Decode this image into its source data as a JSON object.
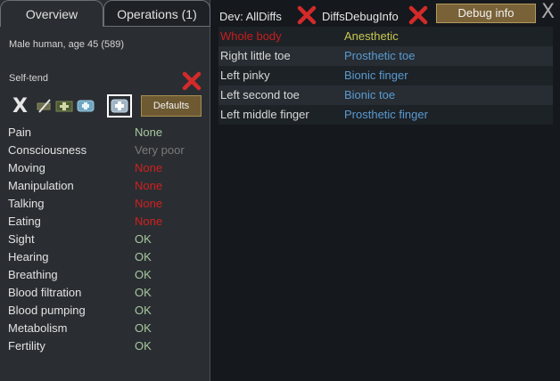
{
  "tabs": {
    "overview": "Overview",
    "operations": "Operations (1)"
  },
  "pawn": {
    "summary": "Male human, age 45 (589)"
  },
  "self_tend": {
    "label": "Self-tend"
  },
  "care": {
    "x_glyph": "X",
    "defaults_label": "Defaults"
  },
  "capacities": [
    {
      "name": "Pain",
      "value": "None",
      "color": "#a8c8a0"
    },
    {
      "name": "Consciousness",
      "value": "Very poor",
      "color": "#7a7a7a"
    },
    {
      "name": "Moving",
      "value": "None",
      "color": "#d02020"
    },
    {
      "name": "Manipulation",
      "value": "None",
      "color": "#d02020"
    },
    {
      "name": "Talking",
      "value": "None",
      "color": "#d02020"
    },
    {
      "name": "Eating",
      "value": "None",
      "color": "#d02020"
    },
    {
      "name": "Sight",
      "value": "OK",
      "color": "#a8c8a0"
    },
    {
      "name": "Hearing",
      "value": "OK",
      "color": "#a8c8a0"
    },
    {
      "name": "Breathing",
      "value": "OK",
      "color": "#a8c8a0"
    },
    {
      "name": "Blood filtration",
      "value": "OK",
      "color": "#a8c8a0"
    },
    {
      "name": "Blood pumping",
      "value": "OK",
      "color": "#a8c8a0"
    },
    {
      "name": "Metabolism",
      "value": "OK",
      "color": "#a8c8a0"
    },
    {
      "name": "Fertility",
      "value": "OK",
      "color": "#a8c8a0"
    }
  ],
  "debug_bar": {
    "all_diffs_label": "Dev: AllDiffs",
    "diffs_debug_label": "DiffsDebugInfo",
    "debug_info_label": "Debug info",
    "close_glyph": "X"
  },
  "diffs": [
    {
      "part": "Whole body",
      "state": "Anesthetic",
      "part_color": "#c81e1e",
      "state_color": "#c8c850"
    },
    {
      "part": "Right little toe",
      "state": "Prosthetic toe",
      "part_color": "#d8d8d8",
      "state_color": "#5a9ad0"
    },
    {
      "part": "Left pinky",
      "state": "Bionic finger",
      "part_color": "#d8d8d8",
      "state_color": "#5a9ad0"
    },
    {
      "part": "Left second toe",
      "state": "Bionic toe",
      "part_color": "#d8d8d8",
      "state_color": "#5a9ad0"
    },
    {
      "part": "Left middle finger",
      "state": "Prosthetic finger",
      "part_color": "#d8d8d8",
      "state_color": "#5a9ad0"
    }
  ]
}
